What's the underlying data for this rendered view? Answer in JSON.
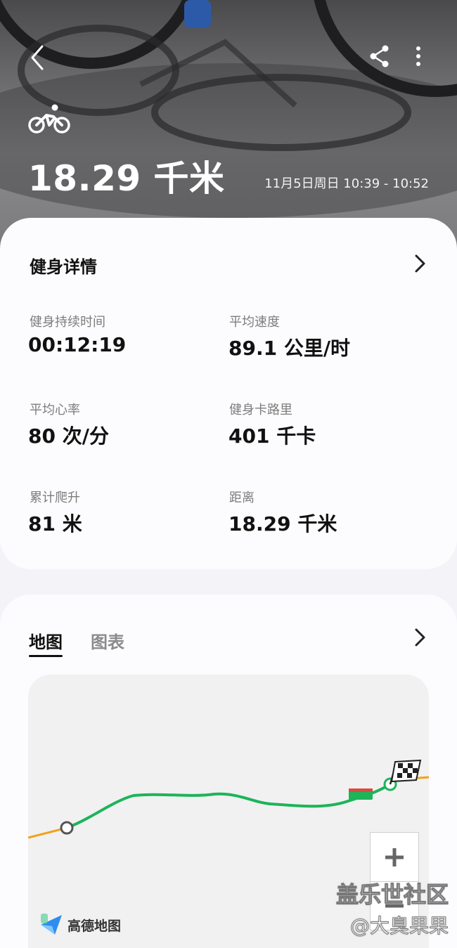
{
  "header": {
    "distance": "18.29 千米",
    "date_range": "11月5日周日 10:39 - 10:52",
    "icons": {
      "back": "back-arrow-icon",
      "share": "share-icon",
      "more": "more-vertical-icon",
      "activity": "bicycle-icon"
    }
  },
  "details": {
    "title": "健身详情",
    "stats": [
      {
        "label": "健身持续时间",
        "value": "00:12:19"
      },
      {
        "label": "平均速度",
        "value": "89.1 公里/时"
      },
      {
        "label": "平均心率",
        "value": "80 次/分"
      },
      {
        "label": "健身卡路里",
        "value": "401 千卡"
      },
      {
        "label": "累计爬升",
        "value": "81 米"
      },
      {
        "label": "距离",
        "value": "18.29 千米"
      }
    ]
  },
  "map_section": {
    "tabs": [
      {
        "label": "地图",
        "active": true
      },
      {
        "label": "图表",
        "active": false
      }
    ],
    "map_logo_text": "高德地图",
    "zoom_in_icon": "plus-icon",
    "zoom_out_icon": "minus-icon",
    "route_color": "#1db45a",
    "route_outside_color": "#f0a21c"
  },
  "watermark": {
    "line1": "盖乐世社区",
    "line2": "@大臭果果"
  }
}
